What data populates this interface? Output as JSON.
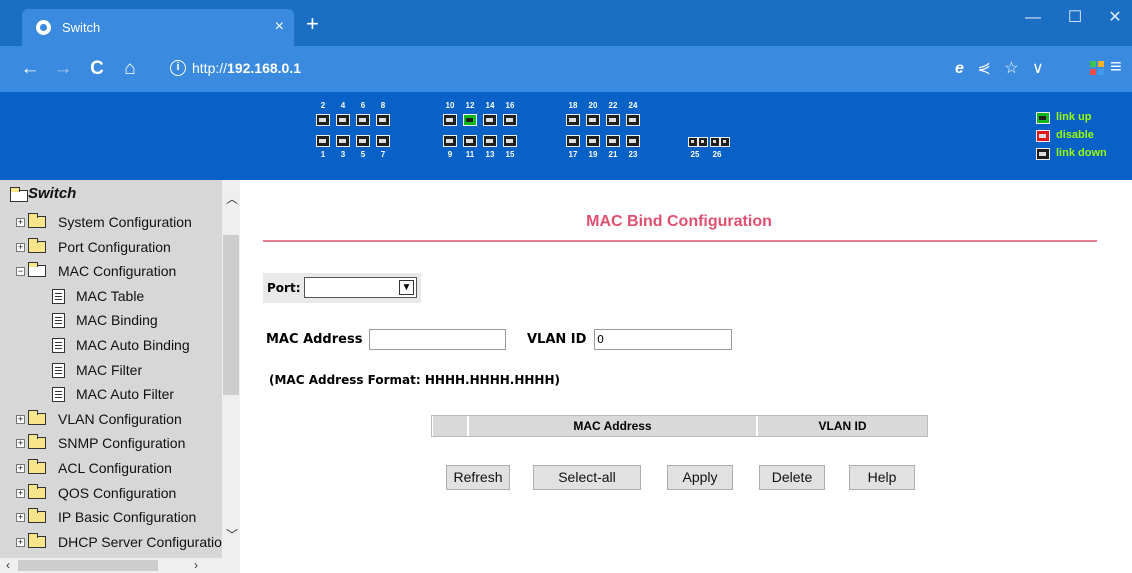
{
  "browser": {
    "tab_title": "Switch",
    "tab_close": "×",
    "new_tab": "+",
    "url_scheme": "http://",
    "url_host": "192.168.0.1",
    "back": "←",
    "forward": "→",
    "reload": "C",
    "home": "⌂",
    "minimize": "—",
    "maximize": "☐",
    "close": "✕",
    "menu": "≡",
    "addr_icons": [
      "e",
      "⋞",
      "☆",
      "∨"
    ]
  },
  "banner": {
    "top_port_numbers": [
      "2",
      "4",
      "6",
      "8",
      "10",
      "12",
      "14",
      "16",
      "18",
      "20",
      "22",
      "24"
    ],
    "bottom_port_numbers": [
      "1",
      "3",
      "5",
      "7",
      "9",
      "11",
      "13",
      "15",
      "17",
      "19",
      "21",
      "23",
      "25",
      "26"
    ],
    "port_up": "12",
    "legend": [
      {
        "label": "link up",
        "state": "up"
      },
      {
        "label": "disable",
        "state": "disabled"
      },
      {
        "label": "link down",
        "state": "down"
      }
    ],
    "colors": {
      "up": "#12b81d",
      "disabled": "#e01818",
      "down": "#1f1f1f",
      "legend_text": "#9cff00"
    }
  },
  "sidebar": {
    "root": "Switch",
    "items": [
      {
        "label": "System Configuration",
        "type": "folder"
      },
      {
        "label": "Port Configuration",
        "type": "folder"
      },
      {
        "label": "MAC Configuration",
        "type": "folder-open"
      },
      {
        "label": "MAC Table",
        "type": "doc"
      },
      {
        "label": "MAC Binding",
        "type": "doc"
      },
      {
        "label": "MAC Auto Binding",
        "type": "doc"
      },
      {
        "label": "MAC Filter",
        "type": "doc"
      },
      {
        "label": "MAC Auto Filter",
        "type": "doc"
      },
      {
        "label": "VLAN Configuration",
        "type": "folder"
      },
      {
        "label": "SNMP Configuration",
        "type": "folder"
      },
      {
        "label": "ACL Configuration",
        "type": "folder"
      },
      {
        "label": "QOS Configuration",
        "type": "folder"
      },
      {
        "label": "IP Basic Configuration",
        "type": "folder"
      },
      {
        "label": "DHCP Server Configuratio",
        "type": "folder"
      }
    ]
  },
  "main": {
    "title": "MAC Bind Configuration",
    "title_color": "#e0506e",
    "port_label": "Port:",
    "port_value": "",
    "mac_label": "MAC Address",
    "mac_value": "",
    "vlan_label": "VLAN ID",
    "vlan_value": "0",
    "format_note": "(MAC Address Format: HHHH.HHHH.HHHH)",
    "table_headers": [
      "",
      "MAC Address",
      "VLAN ID"
    ],
    "buttons": {
      "refresh": "Refresh",
      "select_all": "Select-all",
      "apply": "Apply",
      "delete": "Delete",
      "help": "Help"
    }
  }
}
